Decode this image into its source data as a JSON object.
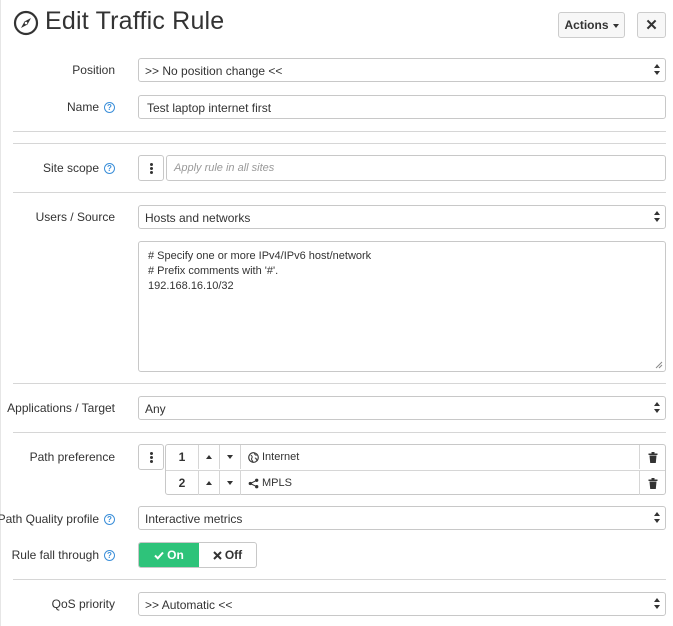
{
  "header": {
    "title": "Edit Traffic Rule",
    "actions_label": "Actions",
    "close_label": "✕"
  },
  "form": {
    "position": {
      "label": "Position",
      "value": ">> No position change <<"
    },
    "name": {
      "label": "Name",
      "value": "Test laptop internet first"
    },
    "site_scope": {
      "label": "Site scope",
      "placeholder": "Apply rule in all sites"
    },
    "users_source": {
      "label": "Users / Source",
      "value": "Hosts and networks",
      "text_lines": [
        "# Specify one or more IPv4/IPv6 host/network",
        "# Prefix comments with '#'.",
        "192.168.16.10/32"
      ]
    },
    "applications_target": {
      "label": "Applications / Target",
      "value": "Any"
    },
    "path_preference": {
      "label": "Path preference",
      "rows": [
        {
          "num": "1",
          "name": "Internet",
          "icon": "globe-icon"
        },
        {
          "num": "2",
          "name": "MPLS",
          "icon": "share-icon"
        }
      ]
    },
    "path_quality_profile": {
      "label": "Path Quality profile",
      "value": "Interactive metrics"
    },
    "rule_fall_through": {
      "label": "Rule fall through",
      "on_label": "On",
      "off_label": "Off",
      "selected": "On"
    },
    "qos_priority": {
      "label": "QoS priority",
      "value": ">> Automatic <<"
    }
  },
  "colors": {
    "toggle_on": "#2ec37a",
    "help_icon": "#3b8fd9"
  }
}
